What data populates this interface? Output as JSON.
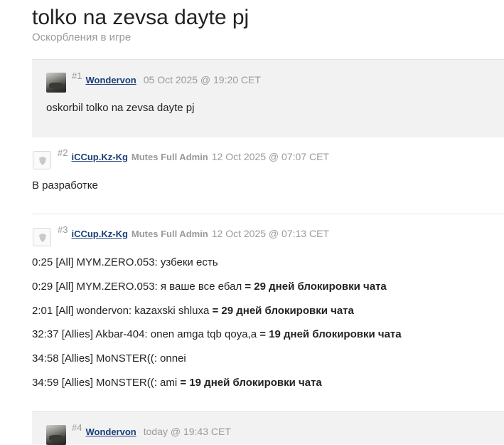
{
  "topic": {
    "title": "tolko na zevsa dayte pj",
    "subtitle": "Оскорбления в игре"
  },
  "posts": [
    {
      "num": "#1",
      "author": "Wondervon",
      "role": "",
      "date": "05 Oct 2025 @ 19:20 CET",
      "avatar": "user-avatar",
      "body": "oskorbil tolko na zevsa dayte pj"
    },
    {
      "num": "#2",
      "author": "iCCup.Kz-Kg",
      "role": "Mutes Full Admin",
      "date": "12 Oct 2025 @ 07:07 CET",
      "avatar": "shield-icon",
      "body": "В разработке"
    },
    {
      "num": "#3",
      "author": "iCCup.Kz-Kg",
      "role": "Mutes Full Admin",
      "date": "12 Oct 2025 @ 07:13 CET",
      "avatar": "shield-icon",
      "lines": [
        {
          "text": "0:25 [All] MYM.ZERO.053: узбеки есть",
          "penalty": ""
        },
        {
          "text": "0:29 [All] MYM.ZERO.053: я ваше все ебал ",
          "penalty": "= 29 дней блокировки чата"
        },
        {
          "text": "2:01 [All] wondervon: kazaxski shluxa ",
          "penalty": "= 29 дней блокировки чата"
        },
        {
          "text": "32:37 [Allies] Akbar-404: onen amga tqb qoya,a ",
          "penalty": "= 19 дней блокировки чата"
        },
        {
          "text": "34:58 [Allies] MoNSTER((: onnei",
          "penalty": ""
        },
        {
          "text": "34:59 [Allies] MoNSTER((: ami ",
          "penalty": "= 19 дней блокировки чата"
        }
      ]
    },
    {
      "num": "#4",
      "author": "Wondervon",
      "role": "",
      "date": "today @ 19:43 CET",
      "avatar": "user-avatar"
    }
  ]
}
